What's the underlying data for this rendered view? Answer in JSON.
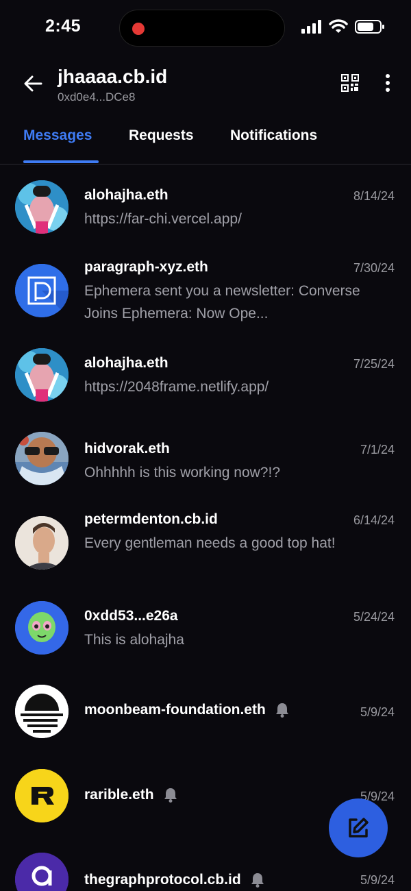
{
  "status": {
    "time": "2:45"
  },
  "header": {
    "title": "jhaaaa.cb.id",
    "subtitle": "0xd0e4...DCe8"
  },
  "tabs": [
    "Messages",
    "Requests",
    "Notifications"
  ],
  "conversations": [
    {
      "name": "alohajha.eth",
      "date": "8/14/24",
      "preview": "https://far-chi.vercel.app/"
    },
    {
      "name": "paragraph-xyz.eth",
      "date": "7/30/24",
      "preview": "Ephemera sent you a newsletter: Converse Joins Ephemera: Now Ope..."
    },
    {
      "name": "alohajha.eth",
      "date": "7/25/24",
      "preview": "https://2048frame.netlify.app/"
    },
    {
      "name": "hidvorak.eth",
      "date": "7/1/24",
      "preview": "Ohhhhh is this working now?!?"
    },
    {
      "name": "petermdenton.cb.id",
      "date": "6/14/24",
      "preview": "Every gentleman needs a good top hat!"
    },
    {
      "name": "0xdd53...e26a",
      "date": "5/24/24",
      "preview": "This is alohajha"
    },
    {
      "name": "moonbeam-foundation.eth",
      "date": "5/9/24",
      "preview": ""
    },
    {
      "name": "rarible.eth",
      "date": "5/9/24",
      "preview": ""
    },
    {
      "name": "thegraphprotocol.cb.id",
      "date": "5/9/24",
      "preview": ""
    }
  ],
  "colors": {
    "accent": "#3f7cf5",
    "background": "#0a090e",
    "fab": "#2d5fe0"
  },
  "icons": {
    "back": "arrow-left-icon",
    "qr": "qr-code-icon",
    "more": "more-vertical-icon",
    "muted": "bell-icon",
    "compose": "compose-icon"
  }
}
